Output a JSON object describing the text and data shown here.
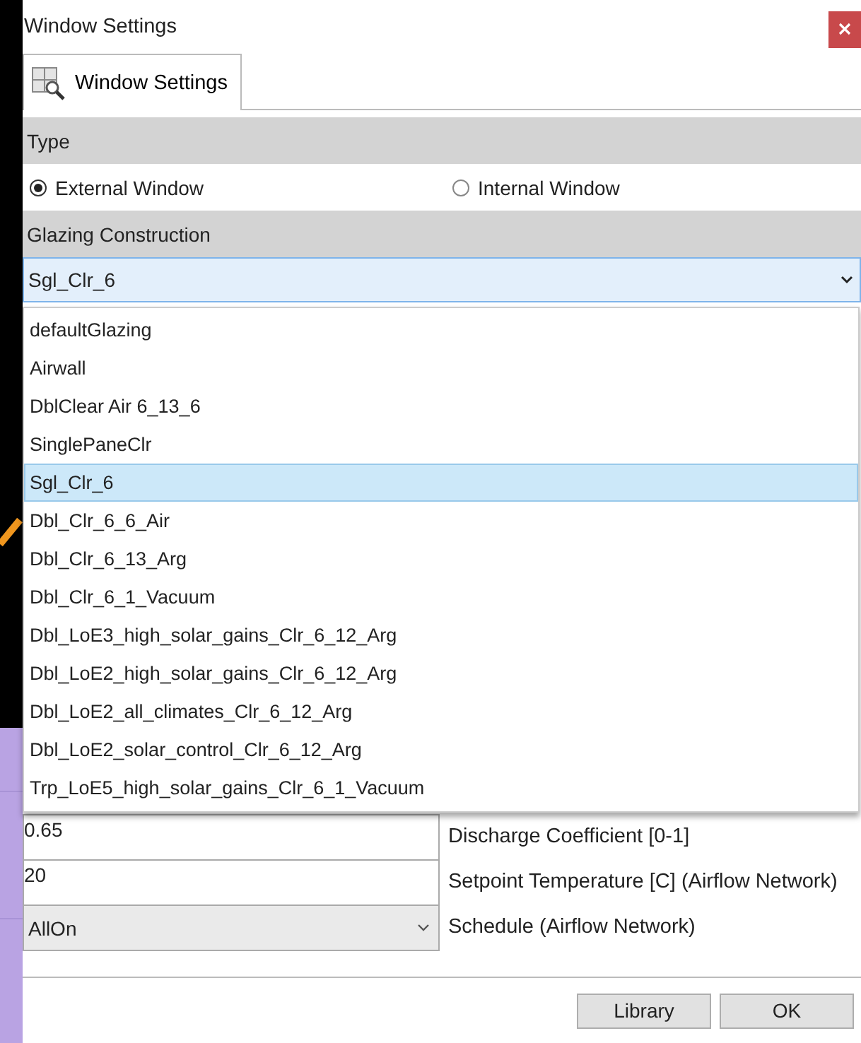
{
  "window": {
    "title": "Window Settings"
  },
  "tabs": [
    {
      "label": "Window Settings",
      "selected": true
    }
  ],
  "type_section": {
    "title": "Type",
    "options": [
      {
        "label": "External Window",
        "selected": true
      },
      {
        "label": "Internal Window",
        "selected": false
      }
    ]
  },
  "glazing_section": {
    "title": "Glazing Construction",
    "value": "Sgl_Clr_6",
    "expanded": true,
    "options": [
      {
        "label": "defaultGlazing",
        "selected": false
      },
      {
        "label": "Airwall",
        "selected": false
      },
      {
        "label": "DblClear Air 6_13_6",
        "selected": false
      },
      {
        "label": "SinglePaneClr",
        "selected": false
      },
      {
        "label": "Sgl_Clr_6",
        "selected": true
      },
      {
        "label": "Dbl_Clr_6_6_Air",
        "selected": false
      },
      {
        "label": "Dbl_Clr_6_13_Arg",
        "selected": false
      },
      {
        "label": "Dbl_Clr_6_1_Vacuum",
        "selected": false
      },
      {
        "label": "Dbl_LoE3_high_solar_gains_Clr_6_12_Arg",
        "selected": false
      },
      {
        "label": "Dbl_LoE2_high_solar_gains_Clr_6_12_Arg",
        "selected": false
      },
      {
        "label": "Dbl_LoE2_all_climates_Clr_6_12_Arg",
        "selected": false
      },
      {
        "label": "Dbl_LoE2_solar_control_Clr_6_12_Arg",
        "selected": false
      },
      {
        "label": "Trp_LoE5_high_solar_gains_Clr_6_1_Vacuum",
        "selected": false
      }
    ]
  },
  "fields": [
    {
      "kind": "text",
      "value": "0.65",
      "label": "Discharge Coefficient [0-1]"
    },
    {
      "kind": "text",
      "value": "20",
      "label": "Setpoint Temperature [C] (Airflow Network)"
    },
    {
      "kind": "combo",
      "value": "AllOn",
      "label": "Schedule (Airflow Network)"
    }
  ],
  "buttons": [
    "Library",
    "OK"
  ]
}
